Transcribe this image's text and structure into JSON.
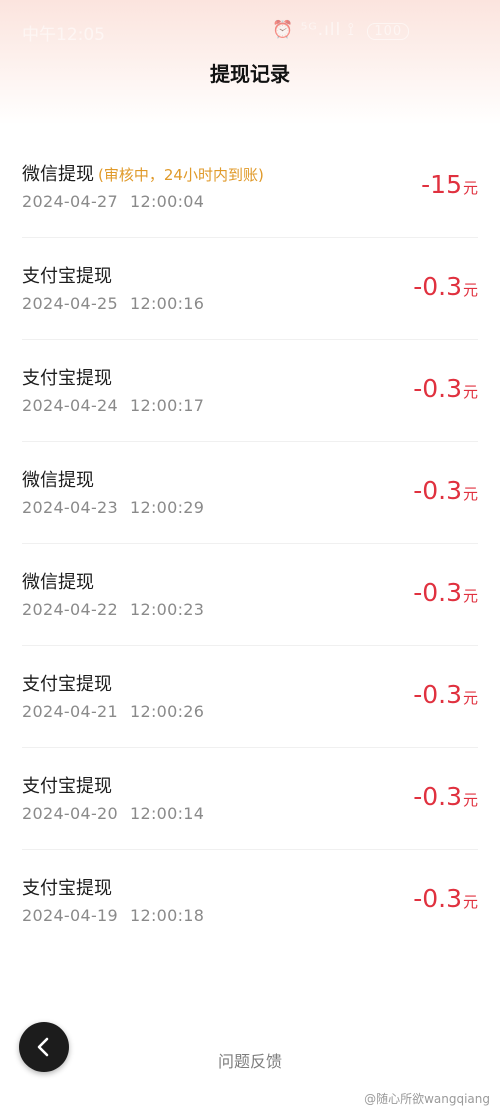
{
  "status_bar": {
    "time": "中午12:05",
    "icons": "⏰ ⁵ᴳ.ıll ⟟",
    "battery": "100"
  },
  "header": {
    "title": "提现记录"
  },
  "records": [
    {
      "title": "微信提现",
      "note": "(审核中，24小时内到账)",
      "date": "2024-04-27",
      "time": "12:00:04",
      "amount": "-15",
      "unit": "元"
    },
    {
      "title": "支付宝提现",
      "note": "",
      "date": "2024-04-25",
      "time": "12:00:16",
      "amount": "-0.3",
      "unit": "元"
    },
    {
      "title": "支付宝提现",
      "note": "",
      "date": "2024-04-24",
      "time": "12:00:17",
      "amount": "-0.3",
      "unit": "元"
    },
    {
      "title": "微信提现",
      "note": "",
      "date": "2024-04-23",
      "time": "12:00:29",
      "amount": "-0.3",
      "unit": "元"
    },
    {
      "title": "微信提现",
      "note": "",
      "date": "2024-04-22",
      "time": "12:00:23",
      "amount": "-0.3",
      "unit": "元"
    },
    {
      "title": "支付宝提现",
      "note": "",
      "date": "2024-04-21",
      "time": "12:00:26",
      "amount": "-0.3",
      "unit": "元"
    },
    {
      "title": "支付宝提现",
      "note": "",
      "date": "2024-04-20",
      "time": "12:00:14",
      "amount": "-0.3",
      "unit": "元"
    },
    {
      "title": "支付宝提现",
      "note": "",
      "date": "2024-04-19",
      "time": "12:00:18",
      "amount": "-0.3",
      "unit": "元"
    }
  ],
  "footer": {
    "feedback_label": "问题反馈",
    "back_icon": "chevron-left-icon"
  },
  "watermark": "@随心所欲wangqiang",
  "colors": {
    "amount": "#e0313f",
    "note": "#e09a2a",
    "header_gradient": "#fbe4de"
  }
}
